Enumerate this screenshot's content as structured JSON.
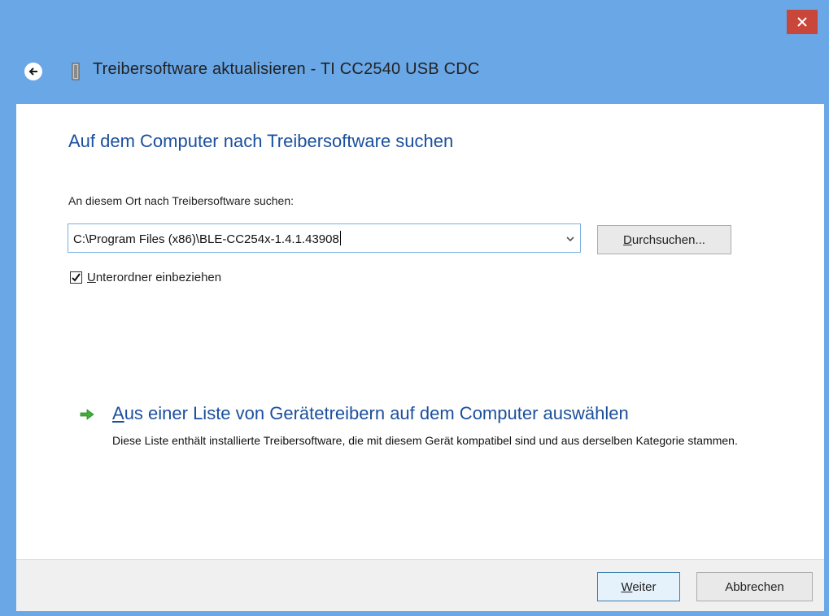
{
  "window": {
    "title": "Treibersoftware aktualisieren - TI CC2540 USB CDC",
    "colors": {
      "frame": "#6aa7e6",
      "close": "#c9463a",
      "heading": "#1b4f9e"
    }
  },
  "icons": {
    "close": "close-icon",
    "back": "back-arrow-icon",
    "device": "usb-device-icon",
    "link_arrow": "green-arrow-icon",
    "dropdown": "chevron-down-icon",
    "checkmark": "checkmark-icon"
  },
  "main": {
    "heading": "Auf dem Computer nach Treibersoftware suchen",
    "path_label": "An diesem Ort nach Treibersoftware suchen:",
    "path_value": "C:\\Program Files (x86)\\BLE-CC254x-1.4.1.43908",
    "browse_label": "Durchsuchen...",
    "checkbox_label": "Unterordner einbeziehen",
    "checkbox_checked": true
  },
  "link": {
    "title": "Aus einer Liste von Gerätetreibern auf dem Computer auswählen",
    "description": "Diese Liste enthält installierte Treibersoftware, die mit diesem Gerät kompatibel sind und aus derselben Kategorie stammen."
  },
  "footer": {
    "next_label": "Weiter",
    "cancel_label": "Abbrechen"
  }
}
